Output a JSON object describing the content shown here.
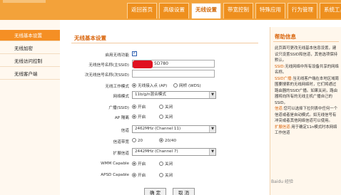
{
  "nav": {
    "tabs": [
      "返回首页",
      "高级设置",
      "无线设置",
      "带宽控制",
      "特殊应用",
      "行为管理",
      "系统工具"
    ],
    "active_index": 2
  },
  "sidebar": {
    "items": [
      "无线基本设置",
      "无线加密",
      "无线访问控制",
      "无线客户端"
    ],
    "active_index": 0
  },
  "form": {
    "title": "无线基本设置",
    "enable_label": "启用无线功能",
    "enable_checked": true,
    "ssid_label": "无线信号名称(主SSID)",
    "ssid_value": "5D780",
    "ssid2_label": "次无线信号名称(次SSID)",
    "ssid2_value": "",
    "mode_label": "无线工作模式",
    "mode_options": [
      "无线接入点 (AP)",
      "网桥 (WDS)"
    ],
    "netmode_label": "网络模式",
    "netmode_value": "11b/g/n混合模式",
    "broadcast_label": "广播(SSID)",
    "broadcast_options": [
      "开启",
      "关闭"
    ],
    "isolation_label": "AP 隔离",
    "isolation_options": [
      "开启",
      "关闭"
    ],
    "channel_label": "信道",
    "channel_value": "2462MHz (Channel 11)",
    "bandwidth_label": "信道带宽",
    "bandwidth_options": [
      "20",
      "20/40"
    ],
    "extchannel_label": "扩展信道",
    "extchannel_value": "2442MHz (Channel 7)",
    "wmm_label": "WMM Capable",
    "wmm_options": [
      "开启",
      "关闭"
    ],
    "apsd_label": "APSD Capable",
    "apsd_options": [
      "开启",
      "关闭"
    ],
    "ok_label": "确 定",
    "cancel_label": "取 消"
  },
  "help": {
    "title": "帮助信息",
    "p1": "此页面可更改无线基本信息设置，建议只设置SSID和信道，其他选项保持默认。",
    "k2": "SSID:",
    "p2": "无线网络中所有设备共享的网络名称。",
    "k3": "SSID广播:",
    "p3": "当无线客户端在本地区域周围要搜索的无线网络时，它们将通过路由器的SSID广播。如果关闭，路由器将向所有的无线主机广播自己的SSID。",
    "k4": "信道:",
    "p4": "您可以选择下拉列表中任何一个信道或者是自动模式。如无线信号有冲突或者其他网络信道可以使用。",
    "k5": "扩展信道:",
    "p5": "用于确定11n模式时本网络工作信道"
  },
  "watermark": "Baidu 经验"
}
